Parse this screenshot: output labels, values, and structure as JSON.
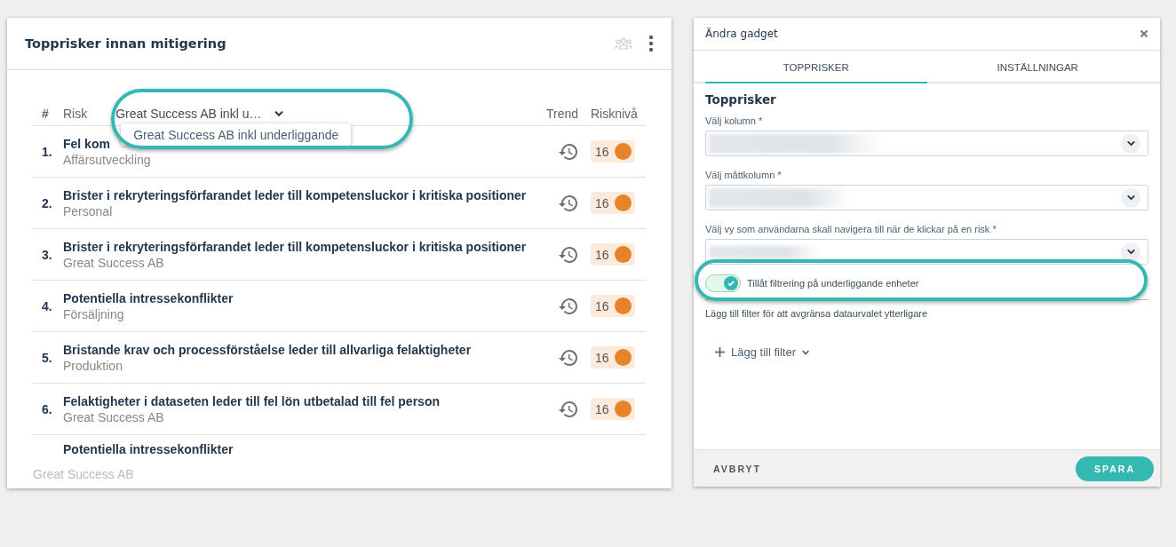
{
  "risk_widget": {
    "title": "Topprisker innan mitigering",
    "columns": {
      "number": "#",
      "risk": "Risk",
      "trend": "Trend",
      "risk_level": "Risknivå"
    },
    "unit_filter": {
      "value": "Great Success AB inkl u…",
      "expanded": true,
      "options": [
        {
          "label": "Great Success AB inkl underliggande",
          "selected": false
        }
      ]
    },
    "rows": [
      {
        "number": "1.",
        "title": "Fel kom",
        "unit": "Affärsutveckling",
        "level": "16",
        "color": "#e8832a"
      },
      {
        "number": "2.",
        "title": "Brister i rekryteringsförfarandet leder till kompetensluckor i kritiska positioner",
        "unit": "Personal",
        "level": "16",
        "color": "#e8832a"
      },
      {
        "number": "3.",
        "title": "Brister i rekryteringsförfarandet leder till kompetensluckor i kritiska positioner",
        "unit": "Great Success AB",
        "level": "16",
        "color": "#e8832a"
      },
      {
        "number": "4.",
        "title": "Potentiella intressekonflikter",
        "unit": "Försäljning",
        "level": "16",
        "color": "#e8832a"
      },
      {
        "number": "5.",
        "title": "Bristande krav och processförståelse leder till allvarliga felaktigheter",
        "unit": "Produktion",
        "level": "16",
        "color": "#e8832a"
      },
      {
        "number": "6.",
        "title": "Felaktigheter i dataseten leder till fel lön utbetalad till fel person",
        "unit": "Great Success AB",
        "level": "16",
        "color": "#e8832a"
      },
      {
        "title": "Potentiella intressekonflikter"
      }
    ],
    "footer": "Great Success AB"
  },
  "gadget_editor": {
    "title": "Ändra gadget",
    "tabs": [
      {
        "label": "TOPPRISKER",
        "selected": true
      },
      {
        "label": "INSTÄLLNINGAR",
        "selected": false
      }
    ],
    "section_title": "Topprisker",
    "fields": [
      {
        "label": "Välj kolumn *"
      },
      {
        "label": "Välj måttkolumn *"
      },
      {
        "label": "Välj vy som användarna skall navigera till när de klickar på en risk *"
      }
    ],
    "toggle": {
      "label": "Tillåt filtrering på underliggande enheter",
      "on": true
    },
    "filter_hint": "Lägg till filter för att avgränsa dataurvalet ytterligare",
    "add_filter": "Lägg till filter",
    "buttons": {
      "cancel": "AVBRYT",
      "save": "SPARA"
    }
  }
}
